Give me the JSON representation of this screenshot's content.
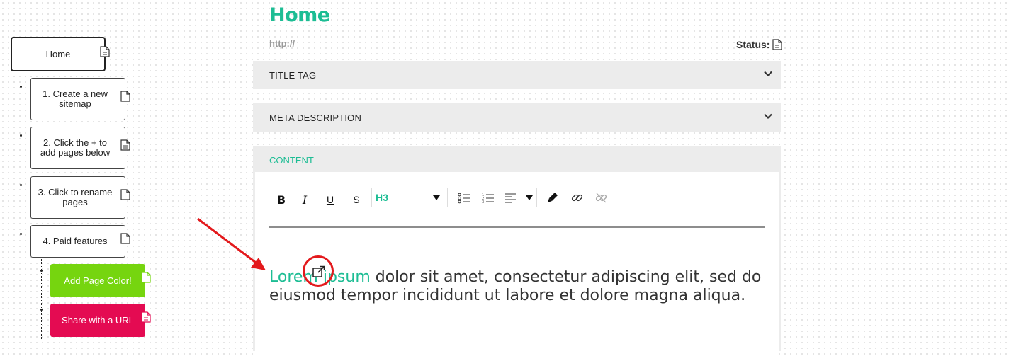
{
  "sitemap": {
    "root": {
      "label": "Home"
    },
    "children": [
      {
        "label": "1. Create a new sitemap"
      },
      {
        "label": "2. Click the + to add pages below"
      },
      {
        "label": "3. Click to rename pages"
      },
      {
        "label": "4. Paid features"
      }
    ],
    "features": [
      {
        "label": "Add Page Color!",
        "color": "#76d50f"
      },
      {
        "label": "Share with a URL",
        "color": "#e40b52"
      }
    ]
  },
  "page": {
    "title": "Home",
    "url": "http://",
    "status_label": "Status:"
  },
  "sections": {
    "title_tag": "TITLE TAG",
    "meta_description": "META DESCRIPTION",
    "content": "CONTENT"
  },
  "toolbar": {
    "heading_value": "H3",
    "bold_label": "B",
    "italic_label": "I",
    "underline_label": "U",
    "strike_label": "S"
  },
  "editor": {
    "lead_text": "Lorem ipsum",
    "body_text": " dolor sit amet, consectetur adipiscing elit, sed do eiusmod tempor incididunt ut labore et dolore magna aliqua."
  },
  "colors": {
    "accent": "#1dbd94",
    "annotation": "#e3191c"
  }
}
